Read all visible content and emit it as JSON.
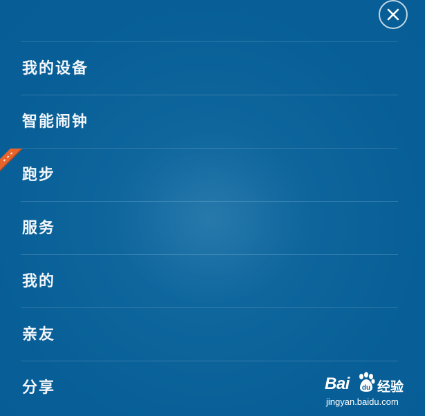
{
  "menu": {
    "items": [
      {
        "label": "我的设备"
      },
      {
        "label": "智能闹钟"
      },
      {
        "label": "跑步"
      },
      {
        "label": "服务"
      },
      {
        "label": "我的"
      },
      {
        "label": "亲友"
      },
      {
        "label": "分享"
      }
    ]
  },
  "close_button": {
    "icon": "close-icon"
  },
  "ribbon": {
    "icon": "new-badge-ribbon",
    "color": "#e8642a"
  },
  "watermark": {
    "brand": "Bai",
    "product": "经验",
    "url": "jingyan.baidu.com"
  },
  "colors": {
    "background": "#0b639b",
    "text": "#f3f6fa",
    "divider": "rgba(255,255,255,0.16)"
  }
}
